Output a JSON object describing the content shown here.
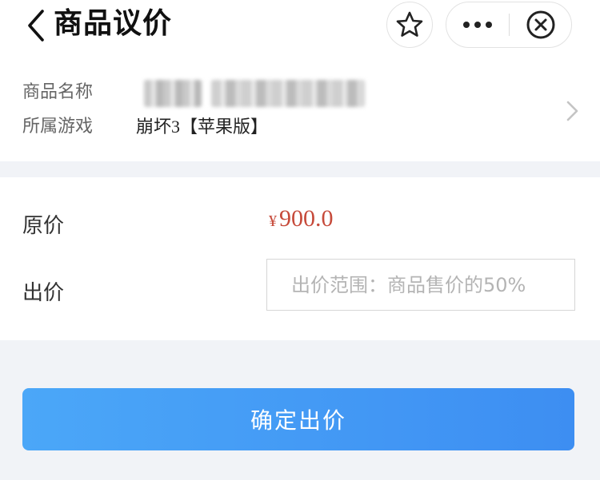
{
  "header": {
    "title": "商品议价",
    "back_icon": "chevron-left-icon",
    "star_icon": "star-icon",
    "more_icon": "more-dots-icon",
    "close_icon": "close-circle-icon"
  },
  "product": {
    "name_label": "商品名称",
    "game_label": "所属游戏",
    "game_value": "崩坏3【苹果版】"
  },
  "price": {
    "original_label": "原价",
    "currency_symbol": "¥",
    "original_value": "900.0",
    "bid_label": "出价",
    "bid_value": "",
    "bid_placeholder": "出价范围：商品售价的50%"
  },
  "actions": {
    "confirm_label": "确定出价"
  },
  "colors": {
    "price_red": "#c64a3a",
    "button_blue": "#3d8ef2",
    "page_background": "#f1f3f7"
  }
}
